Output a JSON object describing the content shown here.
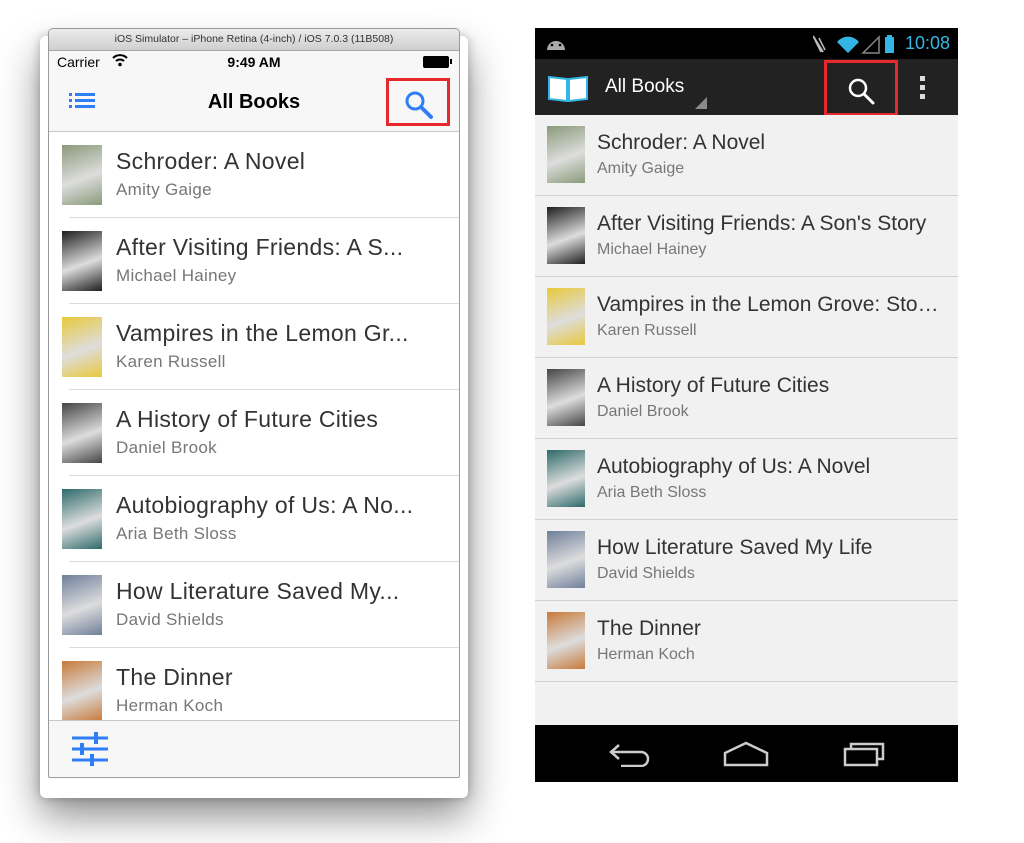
{
  "colors": {
    "ios_tint": "#2f7ef6",
    "highlight_border": "#e8292b",
    "android_holo_blue": "#33b5e5",
    "android_actionbar": "#222222"
  },
  "ios": {
    "simulator_title": "iOS Simulator – iPhone Retina (4-inch) / iOS 7.0.3 (11B508)",
    "status": {
      "carrier": "Carrier",
      "time": "9:49 AM"
    },
    "nav": {
      "title": "All Books",
      "left_icon": "list-icon",
      "right_icon": "search-icon"
    },
    "toolbar": {
      "icon": "sliders-icon"
    },
    "books": [
      {
        "title": "Schroder: A Novel",
        "author": "Amity Gaige",
        "cover": "#8a9a7a"
      },
      {
        "title": "After Visiting Friends: A S...",
        "author": "Michael Hainey",
        "cover": "#1e1e1e"
      },
      {
        "title": "Vampires in the Lemon Gr...",
        "author": "Karen Russell",
        "cover": "#e8c93a"
      },
      {
        "title": "A History of Future Cities",
        "author": "Daniel Brook",
        "cover": "#444444"
      },
      {
        "title": "Autobiography of Us: A No...",
        "author": "Aria Beth Sloss",
        "cover": "#2d6a6a"
      },
      {
        "title": "How Literature Saved My...",
        "author": "David Shields",
        "cover": "#6f7f9a"
      },
      {
        "title": "The Dinner",
        "author": "Herman Koch",
        "cover": "#c87a3a"
      }
    ]
  },
  "android": {
    "status": {
      "time": "10:08"
    },
    "actionbar": {
      "title": "All Books",
      "app_icon": "open-book-icon",
      "search_icon": "search-icon",
      "overflow_icon": "overflow-menu-icon"
    },
    "books": [
      {
        "title": "Schroder: A Novel",
        "author": "Amity Gaige",
        "cover": "#8a9a7a"
      },
      {
        "title": "After Visiting Friends: A Son's Story",
        "author": "Michael Hainey",
        "cover": "#1e1e1e"
      },
      {
        "title": "Vampires in the Lemon Grove: Stori...",
        "author": "Karen Russell",
        "cover": "#e8c93a"
      },
      {
        "title": "A History of Future Cities",
        "author": "Daniel Brook",
        "cover": "#444444"
      },
      {
        "title": "Autobiography of Us: A Novel",
        "author": "Aria Beth Sloss",
        "cover": "#2d6a6a"
      },
      {
        "title": "How Literature Saved My Life",
        "author": "David Shields",
        "cover": "#6f7f9a"
      },
      {
        "title": "The Dinner",
        "author": "Herman Koch",
        "cover": "#c87a3a"
      }
    ],
    "navbar": {
      "back_icon": "back-icon",
      "home_icon": "home-icon",
      "recents_icon": "recent-apps-icon"
    }
  }
}
